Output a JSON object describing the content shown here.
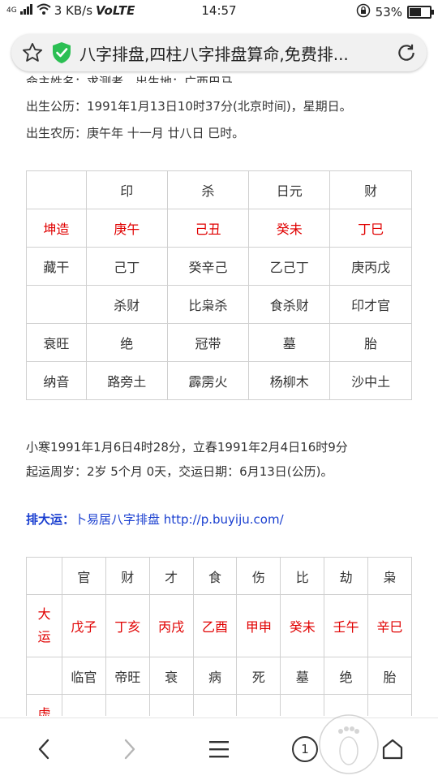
{
  "status": {
    "network": "4G",
    "speed": "3 KB/s",
    "volte": "VoLTE",
    "time": "14:57",
    "battery": "53%"
  },
  "browser": {
    "page_title": "八字排盘,四柱八字排盘算命,免费排..."
  },
  "content": {
    "line_partial": "命主姓名：求测者，出生地：广西巴马。",
    "line_solar": "出生公历：1991年1月13日10时37分(北京时间)，星期日。",
    "line_lunar": "出生农历：庚午年 十一月 廿八日 巳时。",
    "bazi_table": {
      "header": [
        "",
        "印",
        "杀",
        "日元",
        "财"
      ],
      "rows": [
        [
          "坤造",
          "庚午",
          "己丑",
          "癸未",
          "丁巳"
        ],
        [
          "藏干",
          "己丁",
          "癸辛己",
          "乙己丁",
          "庚丙戊"
        ],
        [
          "",
          "杀财",
          "比枭杀",
          "食杀财",
          "印才官"
        ],
        [
          "衰旺",
          "绝",
          "冠带",
          "墓",
          "胎"
        ],
        [
          "纳音",
          "路旁土",
          "霹雳火",
          "杨柳木",
          "沙中土"
        ]
      ]
    },
    "solar_terms": "小寒1991年1月6日4时28分，立春1991年2月4日16时9分",
    "qiyun": "起运周岁：2岁 5个月 0天，交运日期：6月13日(公历)。",
    "dayun_label": "排大运：",
    "dayun_link": "卜易居八字排盘 http://p.buyiju.com/",
    "dayun_table": {
      "header": [
        "",
        "官",
        "财",
        "才",
        "食",
        "伤",
        "比",
        "劫",
        "枭"
      ],
      "row_label_1": "大",
      "row_label_2": "运",
      "ganzhi": [
        "戊子",
        "丁亥",
        "丙戌",
        "乙酉",
        "甲申",
        "癸未",
        "壬午",
        "辛巳"
      ],
      "shuai": [
        "临官",
        "帝旺",
        "衰",
        "病",
        "死",
        "墓",
        "绝",
        "胎"
      ],
      "partial_label": "虚"
    }
  },
  "nav": {
    "tab_count": "1"
  }
}
